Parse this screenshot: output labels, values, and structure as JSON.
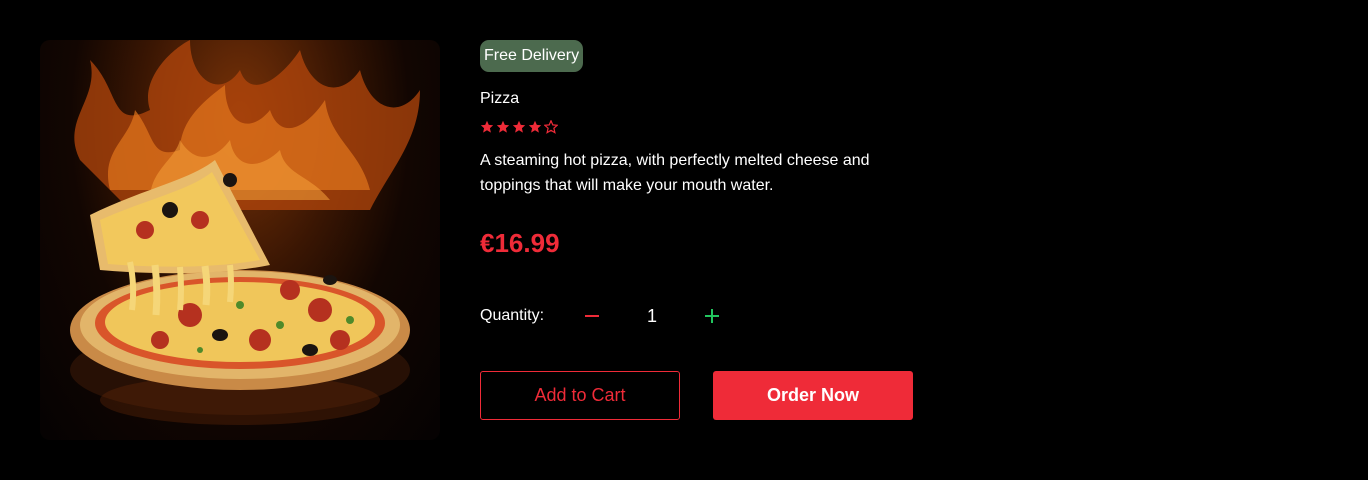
{
  "product": {
    "badge": "Free Delivery",
    "name": "Pizza",
    "rating": 4,
    "rating_max": 5,
    "description": "A steaming hot pizza, with perfectly melted cheese and toppings that will make your mouth water.",
    "price": "€16.99",
    "image_icon": "pizza-photo"
  },
  "quantity": {
    "label": "Quantity:",
    "value": "1",
    "decrement_icon": "minus-icon",
    "increment_icon": "plus-icon"
  },
  "actions": {
    "add_to_cart": "Add to Cart",
    "order_now": "Order Now"
  },
  "colors": {
    "accent": "#ef2b38",
    "badge_bg": "#4c6a4e",
    "increment": "#22c55e",
    "background": "#000000"
  }
}
